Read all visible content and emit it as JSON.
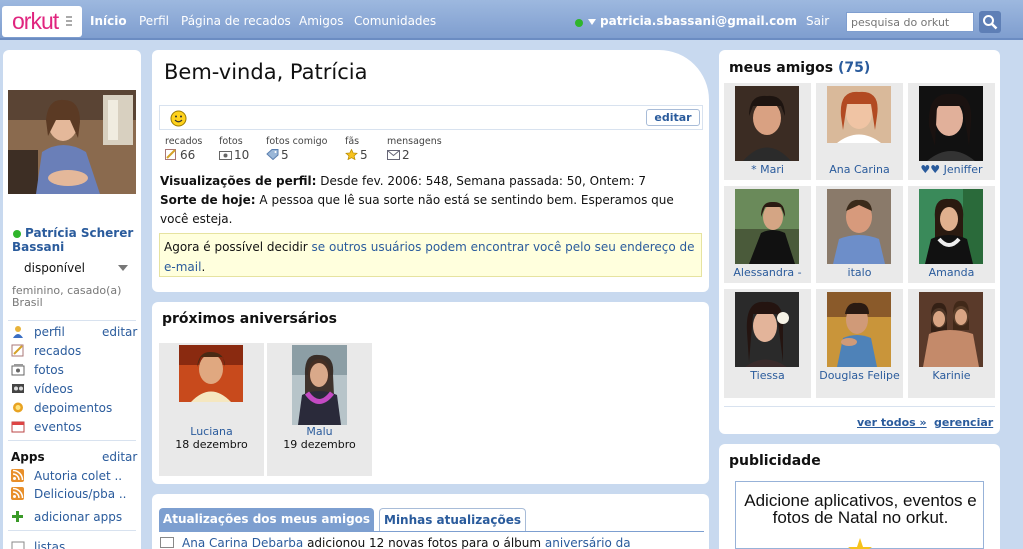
{
  "colors": {
    "brand": "#e0257f",
    "link": "#2a5b9c",
    "topbar": "#8aa9d6",
    "background": "#c8d9ef",
    "online": "#2fb52b"
  },
  "header": {
    "logo": "orkut",
    "nav": [
      "Início",
      "Perfil",
      "Página de recados",
      "Amigos",
      "Comunidades"
    ],
    "user_email": "patricia.sbassani@gmail.com",
    "logout": "Sair",
    "search_placeholder": "pesquisa do orkut"
  },
  "sidebar": {
    "name": "Patrícia Scherer Bassani",
    "status": "disponível",
    "info": "feminino, casado(a)\nBrasil",
    "edit": "editar",
    "menu": [
      {
        "label": "perfil",
        "icon": "user-icon"
      },
      {
        "label": "recados",
        "icon": "notepad-icon"
      },
      {
        "label": "fotos",
        "icon": "photo-icon"
      },
      {
        "label": "vídeos",
        "icon": "video-icon"
      },
      {
        "label": "depoimentos",
        "icon": "sun-icon"
      },
      {
        "label": "eventos",
        "icon": "calendar-icon"
      }
    ],
    "apps_title": "Apps",
    "apps": [
      {
        "label": "Autoria colet ..",
        "icon": "rss-icon"
      },
      {
        "label": "Delicious/pba ..",
        "icon": "rss-icon"
      }
    ],
    "add_apps": "adicionar apps",
    "cut_item": "listas"
  },
  "welcome": {
    "title": "Bem-vinda, Patrícia",
    "edit_button": "editar",
    "stats": [
      {
        "label": "recados",
        "value": "66",
        "icon": "notepad-icon"
      },
      {
        "label": "fotos",
        "value": "10",
        "icon": "photo-icon"
      },
      {
        "label": "fotos comigo",
        "value": "5",
        "icon": "tag-icon"
      },
      {
        "label": "fãs",
        "value": "5",
        "icon": "star-icon"
      },
      {
        "label": "mensagens",
        "value": "2",
        "icon": "envelope-icon"
      }
    ],
    "views_label": "Visualizações de perfil:",
    "views_text": " Desde fev. 2006: 548, Semana passada: 50, Ontem: 7",
    "fortune_label": "Sorte de hoje:",
    "fortune_text": " A pessoa que lê sua sorte não está se sentindo bem. Esperamos que você esteja.",
    "notice_prefix": "Agora é possível decidir ",
    "notice_link": "se outros usuários podem encontrar você pelo seu endereço de e-mail",
    "notice_suffix": "."
  },
  "birthdays": {
    "title": "próximos aniversários",
    "people": [
      {
        "name": "Luciana",
        "date": "18 dezembro"
      },
      {
        "name": "Malu",
        "date": "19 dezembro"
      }
    ]
  },
  "updates": {
    "tab_friends": "Atualizações dos meus amigos",
    "tab_mine": "Minhas atualizações",
    "item_name": "Ana Carina Debarba",
    "item_text": " adicionou 12 novas fotos para o álbum ",
    "item_album": "aniversário da"
  },
  "friends": {
    "title": "meus amigos",
    "count": "(75)",
    "list": [
      "* Mari",
      "Ana Carina",
      "♥♥ Jeniffer",
      "Alessandra -",
      "italo",
      "Amanda",
      "Tiessa",
      "Douglas Felipe",
      "Karinie"
    ],
    "see_all": "ver todos »",
    "manage": "gerenciar"
  },
  "ads": {
    "title": "publicidade",
    "banner_text": "Adicione aplicativos, eventos e fotos de Natal no orkut."
  }
}
